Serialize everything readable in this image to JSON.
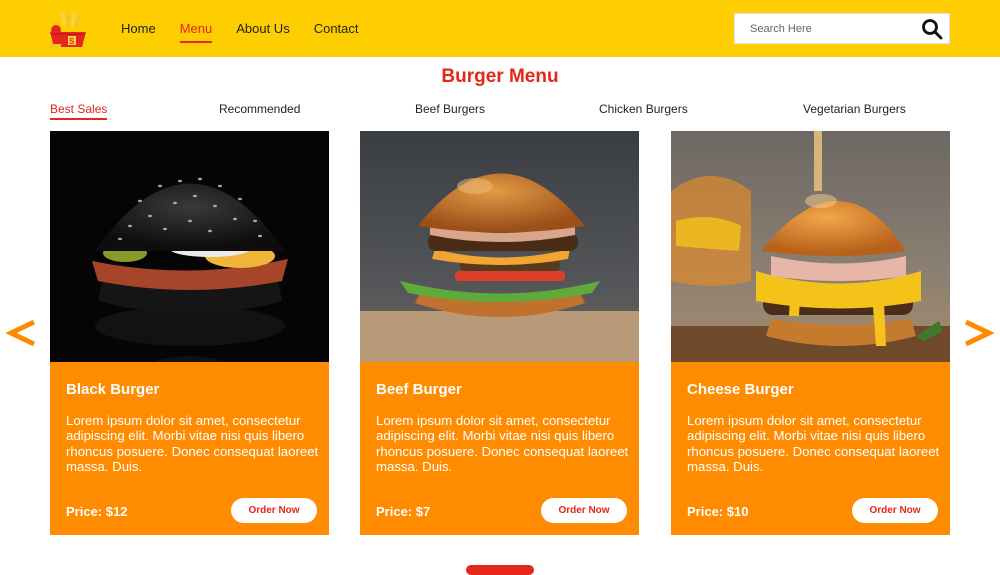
{
  "header": {
    "nav": [
      "Home",
      "Menu",
      "About Us",
      "Contact"
    ],
    "active_nav": "Menu",
    "search_placeholder": "Search Here"
  },
  "page_title": "Burger Menu",
  "tabs": [
    "Best Sales",
    "Recommended",
    "Beef Burgers",
    "Chicken Burgers",
    "Vegetarian Burgers"
  ],
  "active_tab": "Best Sales",
  "carousel": {
    "prev_icon": "chevron-left-icon",
    "next_icon": "chevron-right-icon"
  },
  "cards": [
    {
      "name": "Black Burger",
      "description": "Lorem ipsum dolor sit amet, consectetur adipiscing elit. Morbi vitae nisi quis libero rhoncus posuere. Donec consequat laoreet massa. Duis.",
      "price": "Price: $12",
      "button": "Order Now"
    },
    {
      "name": "Beef Burger",
      "description": "Lorem ipsum dolor sit amet, consectetur adipiscing elit. Morbi vitae nisi quis libero rhoncus posuere. Donec consequat laoreet massa. Duis.",
      "price": "Price: $7",
      "button": "Order Now"
    },
    {
      "name": "Cheese Burger",
      "description": "Lorem ipsum dolor sit amet, consectetur adipiscing elit. Morbi vitae nisi quis libero rhoncus posuere. Donec consequat laoreet massa. Duis.",
      "price": "Price: $10",
      "button": "Order Now"
    }
  ],
  "colors": {
    "header_bg": "#ffce00",
    "accent_red": "#e5261a",
    "card_orange": "#fe8b00"
  }
}
